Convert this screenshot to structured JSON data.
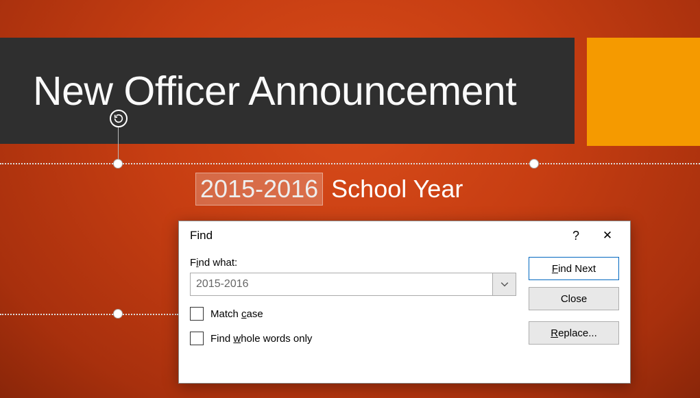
{
  "slide": {
    "title": "New Officer Announcement",
    "subtitle_highlight": "2015-2016",
    "subtitle_rest": "School Year"
  },
  "dialog": {
    "title": "Find",
    "help_symbol": "?",
    "close_symbol": "✕",
    "find_what_label_pre": "F",
    "find_what_underline": "i",
    "find_what_label_post": "nd what:",
    "find_value": "2015-2016",
    "match_case_pre": "Match ",
    "match_case_underline": "c",
    "match_case_post": "ase",
    "whole_words_pre": "Find ",
    "whole_words_underline": "w",
    "whole_words_post": "hole words only",
    "find_next_underline": "F",
    "find_next_post": "ind Next",
    "close_label": "Close",
    "replace_underline": "R",
    "replace_post": "eplace..."
  }
}
